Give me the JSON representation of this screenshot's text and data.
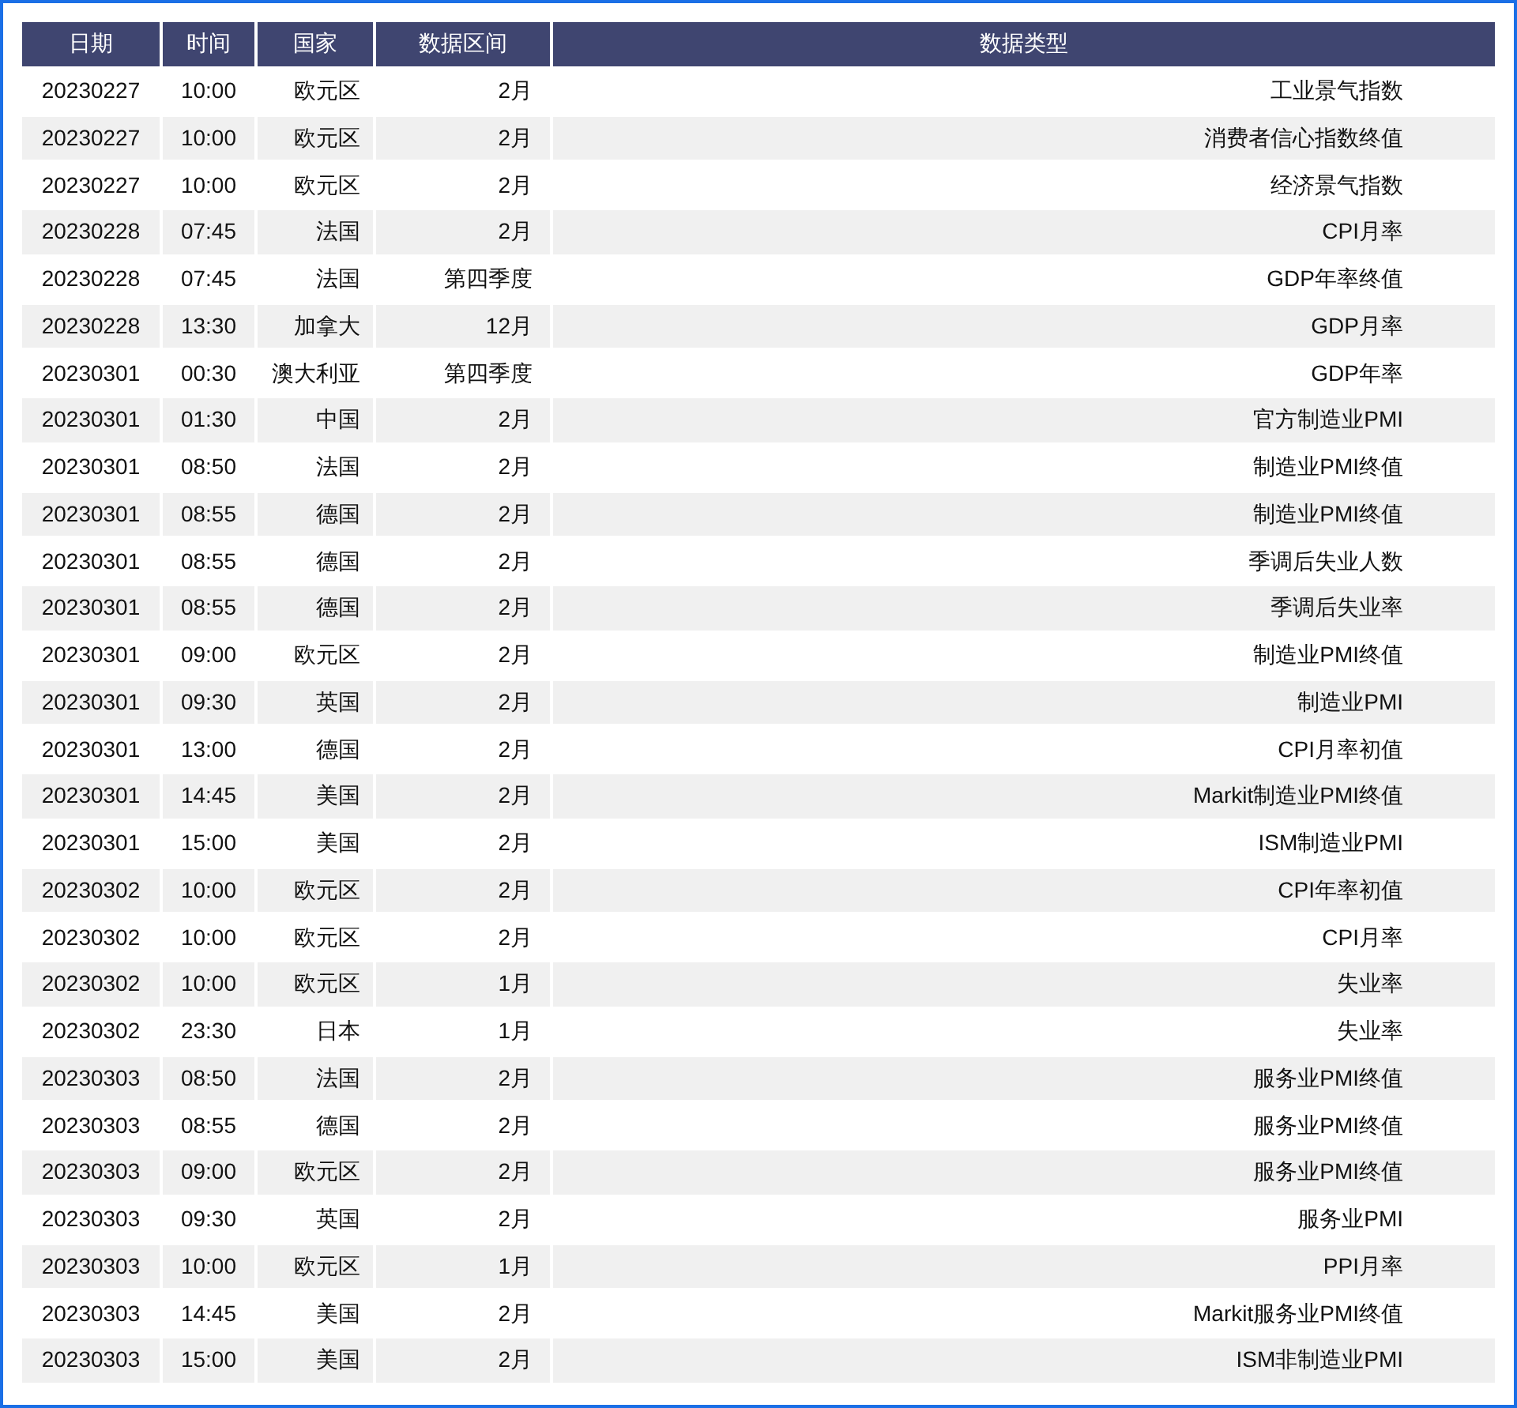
{
  "table": {
    "columns": [
      "日期",
      "时间",
      "国家",
      "数据区间",
      "数据类型"
    ],
    "rows": [
      [
        "20230227",
        "10:00",
        "欧元区",
        "2月",
        "工业景气指数"
      ],
      [
        "20230227",
        "10:00",
        "欧元区",
        "2月",
        "消费者信心指数终值"
      ],
      [
        "20230227",
        "10:00",
        "欧元区",
        "2月",
        "经济景气指数"
      ],
      [
        "20230228",
        "07:45",
        "法国",
        "2月",
        "CPI月率"
      ],
      [
        "20230228",
        "07:45",
        "法国",
        "第四季度",
        "GDP年率终值"
      ],
      [
        "20230228",
        "13:30",
        "加拿大",
        "12月",
        "GDP月率"
      ],
      [
        "20230301",
        "00:30",
        "澳大利亚",
        "第四季度",
        "GDP年率"
      ],
      [
        "20230301",
        "01:30",
        "中国",
        "2月",
        "官方制造业PMI"
      ],
      [
        "20230301",
        "08:50",
        "法国",
        "2月",
        "制造业PMI终值"
      ],
      [
        "20230301",
        "08:55",
        "德国",
        "2月",
        "制造业PMI终值"
      ],
      [
        "20230301",
        "08:55",
        "德国",
        "2月",
        "季调后失业人数"
      ],
      [
        "20230301",
        "08:55",
        "德国",
        "2月",
        "季调后失业率"
      ],
      [
        "20230301",
        "09:00",
        "欧元区",
        "2月",
        "制造业PMI终值"
      ],
      [
        "20230301",
        "09:30",
        "英国",
        "2月",
        "制造业PMI"
      ],
      [
        "20230301",
        "13:00",
        "德国",
        "2月",
        "CPI月率初值"
      ],
      [
        "20230301",
        "14:45",
        "美国",
        "2月",
        "Markit制造业PMI终值"
      ],
      [
        "20230301",
        "15:00",
        "美国",
        "2月",
        "ISM制造业PMI"
      ],
      [
        "20230302",
        "10:00",
        "欧元区",
        "2月",
        "CPI年率初值"
      ],
      [
        "20230302",
        "10:00",
        "欧元区",
        "2月",
        "CPI月率"
      ],
      [
        "20230302",
        "10:00",
        "欧元区",
        "1月",
        "失业率"
      ],
      [
        "20230302",
        "23:30",
        "日本",
        "1月",
        "失业率"
      ],
      [
        "20230303",
        "08:50",
        "法国",
        "2月",
        "服务业PMI终值"
      ],
      [
        "20230303",
        "08:55",
        "德国",
        "2月",
        "服务业PMI终值"
      ],
      [
        "20230303",
        "09:00",
        "欧元区",
        "2月",
        "服务业PMI终值"
      ],
      [
        "20230303",
        "09:30",
        "英国",
        "2月",
        "服务业PMI"
      ],
      [
        "20230303",
        "10:00",
        "欧元区",
        "1月",
        "PPI月率"
      ],
      [
        "20230303",
        "14:45",
        "美国",
        "2月",
        "Markit服务业PMI终值"
      ],
      [
        "20230303",
        "15:00",
        "美国",
        "2月",
        "ISM非制造业PMI"
      ]
    ]
  }
}
